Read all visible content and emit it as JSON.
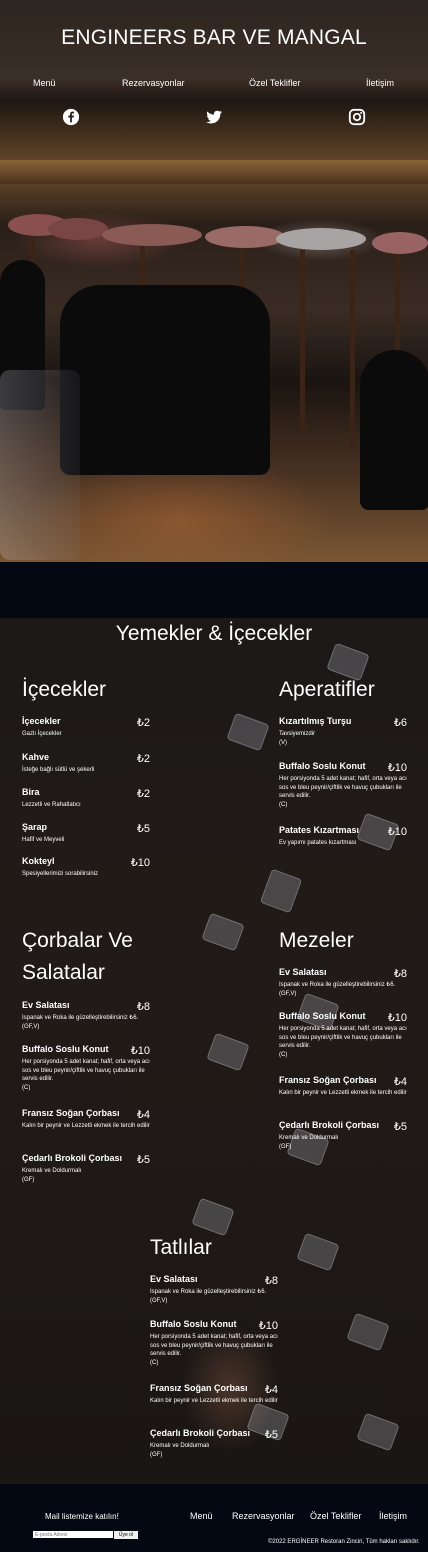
{
  "brand": {
    "title": "ENGINEERS BAR VE MANGAL"
  },
  "nav": {
    "items": [
      "Menü",
      "Rezervasyonlar",
      "Özel Teklifler",
      "İletişim"
    ]
  },
  "social": {
    "icons": [
      "facebook-icon",
      "twitter-icon",
      "instagram-icon"
    ]
  },
  "menu": {
    "title": "Yemekler & İçecekler",
    "sections": [
      {
        "title": "İçecekler",
        "items": [
          {
            "name": "İçecekler",
            "price": "₺2",
            "desc": "Gazlı İçecekler"
          },
          {
            "name": "Kahve",
            "price": "₺2",
            "desc": "İsteğe bağlı sütlü ve şekerli"
          },
          {
            "name": "Bira",
            "price": "₺2",
            "desc": "Lezzetli ve Rahatlatıcı"
          },
          {
            "name": "Şarap",
            "price": "₺5",
            "desc": "Hafif ve Meyveli"
          },
          {
            "name": "Kokteyl",
            "price": "₺10",
            "desc": "Spesiyellerimizi sorabilirsiniz"
          }
        ]
      },
      {
        "title": "Aperatifler",
        "items": [
          {
            "name": "Kızartılmış Turşu",
            "price": "₺6",
            "desc": "Tavsiyemizdir",
            "tag": "(V)"
          },
          {
            "name": "Buffalo Soslu Konut",
            "price": "₺10",
            "desc": "Her porsiyonda 5 adet kanat; hafif, orta veya acı sos ve bleu peynir/çiftlik ve havuç çubukları ile servis edilir.",
            "tag": "(C)"
          },
          {
            "name": "Patates Kızartması",
            "price": "₺10",
            "desc": "Ev yapımı patates kızartması"
          }
        ]
      },
      {
        "title": "Çorbalar Ve Salatalar",
        "items": [
          {
            "name": "Ev Salatası",
            "price": "₺8",
            "desc": "Ispanak ve Roka ile güzelleştirebilirsiniz ₺6.",
            "tag": "(GF,V)"
          },
          {
            "name": "Buffalo Soslu Konut",
            "price": "₺10",
            "desc": "Her porsiyonda 5 adet kanat; hafif, orta veya acı sos ve bleu peynir/çiftlik ve havuç çubukları ile servis edilir.",
            "tag": "(C)"
          },
          {
            "name": "Fransız Soğan Çorbası",
            "price": "₺4",
            "desc": "Kalın bir peynir ve Lezzetli ekmek ile tercih edilir"
          },
          {
            "name": "Çedarlı Brokoli Çorbası",
            "price": "₺5",
            "desc": "Kremalı ve Doldurmalı",
            "tag": "(GF)"
          }
        ]
      },
      {
        "title": "Mezeler",
        "items": [
          {
            "name": "Ev Salatası",
            "price": "₺8",
            "desc": "Ispanak ve Roka ile güzelleştirebilirsiniz ₺6.",
            "tag": "(GF,V)"
          },
          {
            "name": "Buffalo Soslu Konut",
            "price": "₺10",
            "desc": "Her porsiyonda 5 adet kanat; hafif, orta veya acı sos ve bleu peynir/çiftlik ve havuç çubukları ile servis edilir.",
            "tag": "(C)"
          },
          {
            "name": "Fransız Soğan Çorbası",
            "price": "₺4",
            "desc": "Kalın bir peynir ve Lezzetli ekmek ile tercih edilir"
          },
          {
            "name": "Çedarlı Brokoli Çorbası",
            "price": "₺5",
            "desc": "Kremalı ve Doldurmalı",
            "tag": "(GF)"
          }
        ]
      },
      {
        "title": "Tatlılar",
        "items": [
          {
            "name": "Ev Salatası",
            "price": "₺8",
            "desc": "Ispanak ve Roka ile güzelleştirebilirsiniz ₺6.",
            "tag": "(GF,V)"
          },
          {
            "name": "Buffalo Soslu Konut",
            "price": "₺10",
            "desc": "Her porsiyonda 5 adet kanat; hafif, orta veya acı sos ve bleu peynir/çiftlik ve havuç çubukları ile servis edilir.",
            "tag": "(C)"
          },
          {
            "name": "Fransız Soğan Çorbası",
            "price": "₺4",
            "desc": "Kalın bir peynir ve Lezzetli ekmek ile tercih edilir"
          },
          {
            "name": "Çedarlı Brokoli Çorbası",
            "price": "₺5",
            "desc": "Kremalı ve Doldurmalı",
            "tag": "(GF)"
          }
        ]
      }
    ]
  },
  "footer": {
    "subscribe_title": "Mail listemize katılın!",
    "email_placeholder": "E-posta Adresi",
    "subscribe_button": "Üye ol",
    "nav": [
      "Menü",
      "Rezervasyonlar",
      "Özel Teklifler",
      "İletişim"
    ],
    "copyright": "©2022 ERGİNEER Restoran Zinciri, Tüm hakları saklıdır."
  },
  "colors": {
    "page_bg": "#040813",
    "text": "#ffffff"
  }
}
